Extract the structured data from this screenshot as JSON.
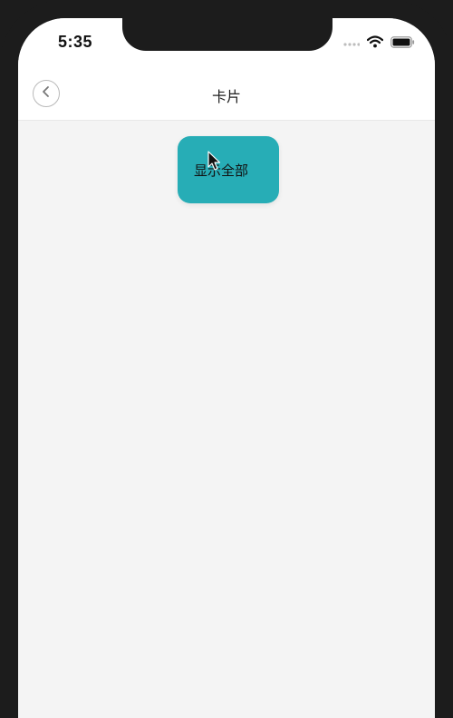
{
  "status_bar": {
    "time": "5:35",
    "icons": [
      "signal-dots-icon",
      "wifi-icon",
      "battery-icon"
    ]
  },
  "nav": {
    "back_icon": "chevron-left-icon",
    "title": "卡片"
  },
  "main": {
    "show_all_label": "显示全部",
    "button_color": "#27adb6"
  },
  "colors": {
    "frame": "#1c1c1c",
    "background": "#f4f4f4",
    "header": "#ffffff"
  }
}
